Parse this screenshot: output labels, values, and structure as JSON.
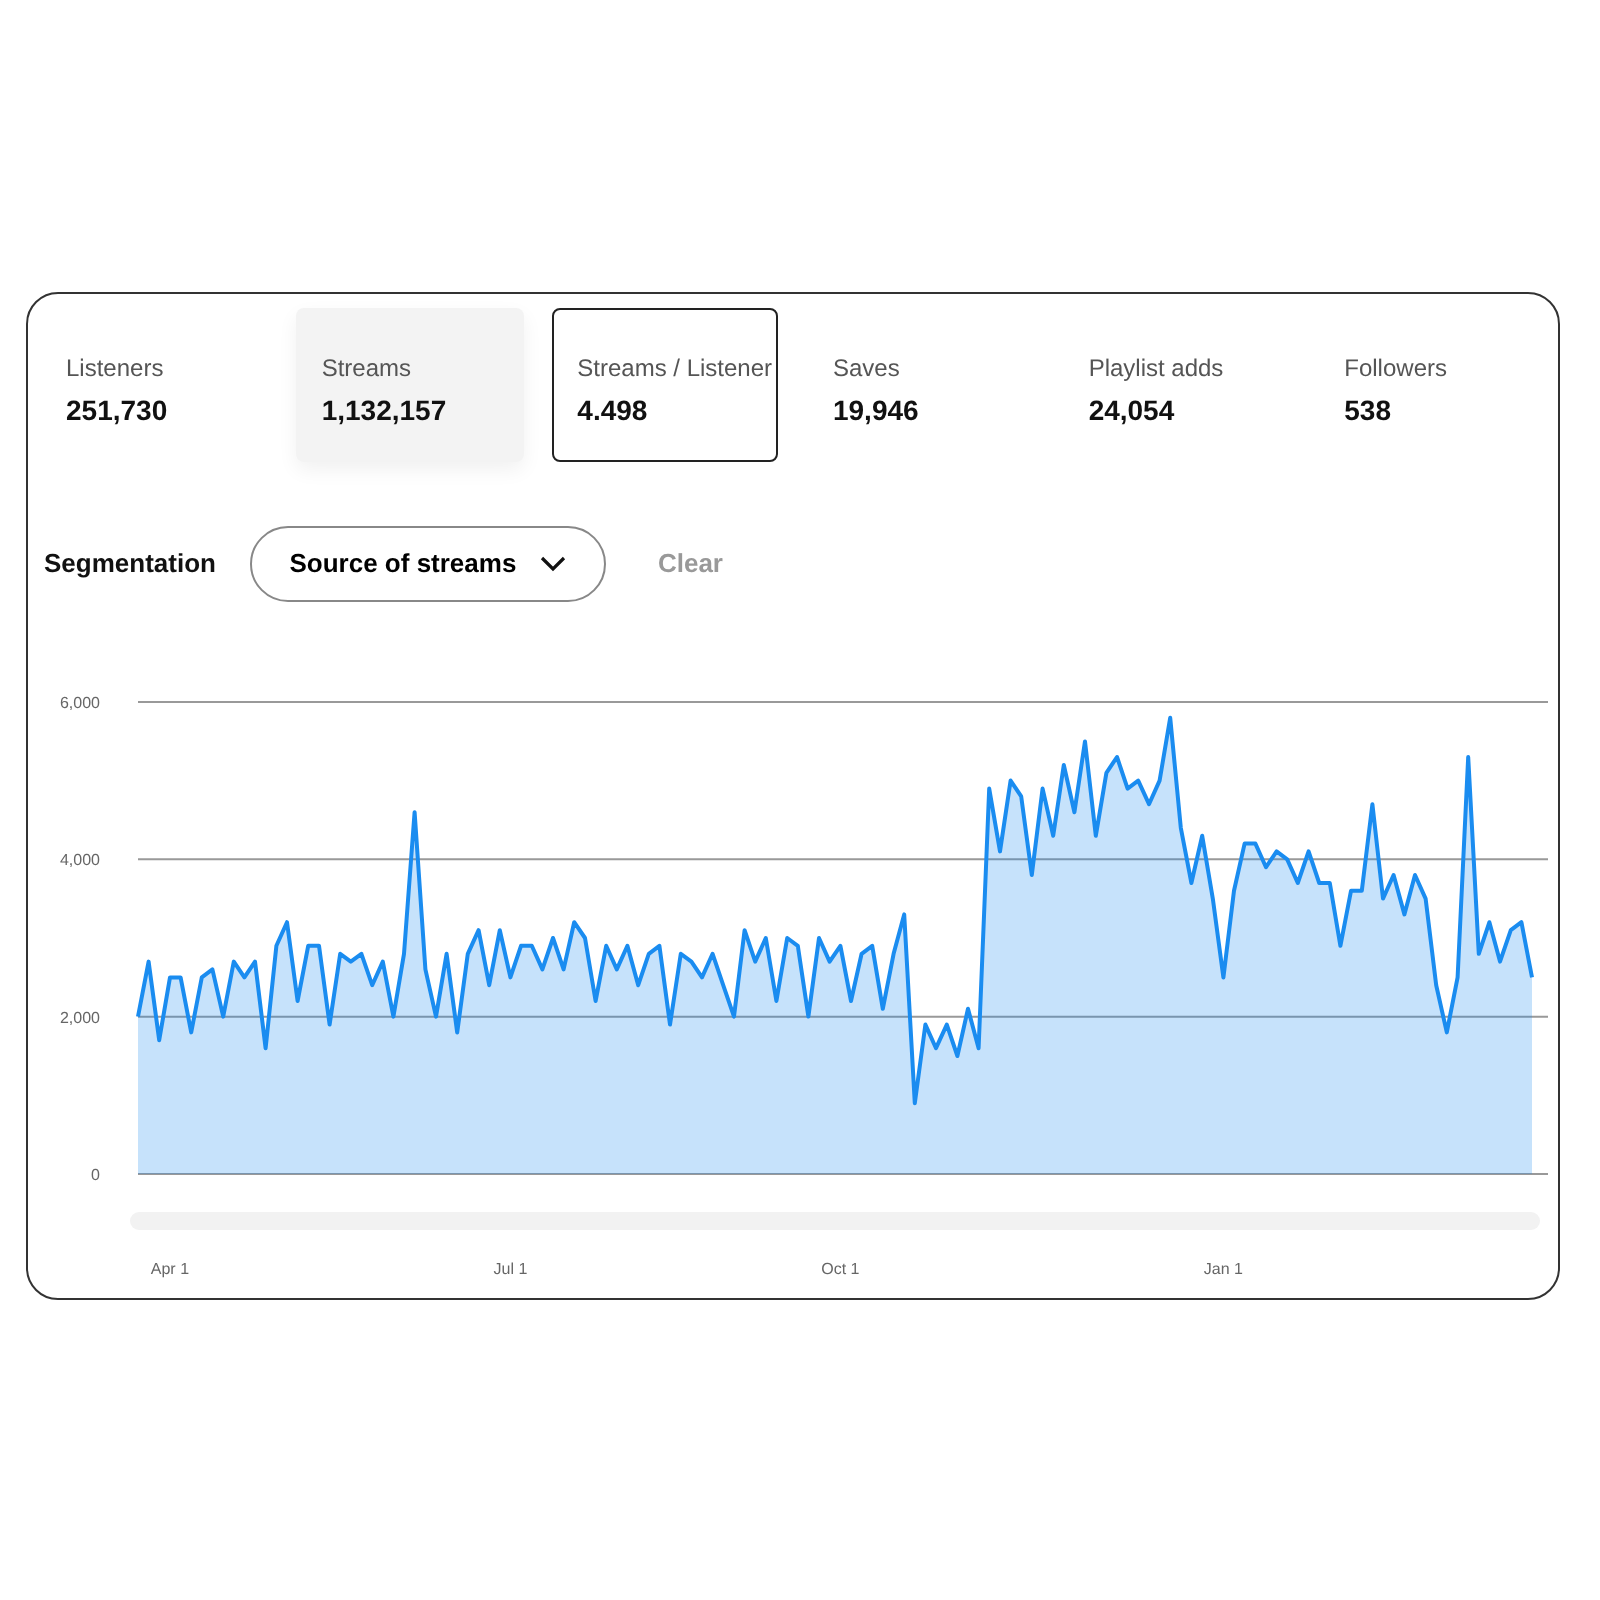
{
  "metrics": [
    {
      "label": "Listeners",
      "value": "251,730",
      "selected": false,
      "hovered": false
    },
    {
      "label": "Streams",
      "value": "1,132,157",
      "selected": false,
      "hovered": true
    },
    {
      "label": "Streams / Listener",
      "value": "4.498",
      "selected": true,
      "hovered": false
    },
    {
      "label": "Saves",
      "value": "19,946",
      "selected": false,
      "hovered": false
    },
    {
      "label": "Playlist adds",
      "value": "24,054",
      "selected": false,
      "hovered": false
    },
    {
      "label": "Followers",
      "value": "538",
      "selected": false,
      "hovered": false
    }
  ],
  "segmentation": {
    "label": "Segmentation",
    "dropdown": "Source of streams",
    "clear": {
      "label": "Clear",
      "disabled": true
    }
  },
  "chart": {
    "chart_data": {
      "type": "area",
      "ylim": [
        0,
        6000
      ],
      "yticks": [
        {
          "value": 0,
          "label": "0"
        },
        {
          "value": 2000,
          "label": "2,000"
        },
        {
          "value": 4000,
          "label": "4,000"
        },
        {
          "value": 6000,
          "label": "6,000"
        }
      ],
      "categories": [
        null,
        null,
        null,
        "Apr 1",
        null,
        null,
        null,
        null,
        null,
        null,
        null,
        null,
        null,
        null,
        null,
        null,
        null,
        null,
        null,
        null,
        null,
        null,
        null,
        null,
        null,
        null,
        null,
        null,
        null,
        null,
        null,
        null,
        null,
        null,
        null,
        "Jul 1",
        null,
        null,
        null,
        null,
        null,
        null,
        null,
        null,
        null,
        null,
        null,
        null,
        null,
        null,
        null,
        null,
        null,
        null,
        null,
        null,
        null,
        null,
        null,
        null,
        null,
        null,
        null,
        null,
        null,
        null,
        "Oct 1",
        null,
        null,
        null,
        null,
        null,
        null,
        null,
        null,
        null,
        null,
        null,
        null,
        null,
        null,
        null,
        null,
        null,
        null,
        null,
        null,
        null,
        null,
        null,
        null,
        null,
        null,
        null,
        null,
        null,
        null,
        null,
        null,
        null,
        null,
        null,
        "Jan 1",
        null,
        null,
        null,
        null,
        null,
        null,
        null,
        null,
        null,
        null,
        null,
        null,
        null,
        null,
        null,
        null,
        null,
        null,
        null,
        null,
        null,
        null,
        null,
        null,
        null,
        null,
        null,
        null,
        null
      ],
      "series": [
        {
          "color": "#1a8cf0",
          "values": [
            2000,
            2700,
            1700,
            2500,
            2500,
            1800,
            2500,
            2600,
            2000,
            2700,
            2500,
            2700,
            1600,
            2900,
            3200,
            2200,
            2900,
            2900,
            1900,
            2800,
            2700,
            2800,
            2400,
            2700,
            2000,
            2800,
            4600,
            2600,
            2000,
            2800,
            1800,
            2800,
            3100,
            2400,
            3100,
            2500,
            2900,
            2900,
            2600,
            3000,
            2600,
            3200,
            3000,
            2200,
            2900,
            2600,
            2900,
            2400,
            2800,
            2900,
            1900,
            2800,
            2700,
            2500,
            2800,
            2400,
            2000,
            3100,
            2700,
            3000,
            2200,
            3000,
            2900,
            2000,
            3000,
            2700,
            2900,
            2200,
            2800,
            2900,
            2100,
            2800,
            3300,
            900,
            1900,
            1600,
            1900,
            1500,
            2100,
            1600,
            4900,
            4100,
            5000,
            4800,
            3800,
            4900,
            4300,
            5200,
            4600,
            5500,
            4300,
            5100,
            5300,
            4900,
            5000,
            4700,
            5000,
            5800,
            4400,
            3700,
            4300,
            3500,
            2500,
            3600,
            4200,
            4200,
            3900,
            4100,
            4000,
            3700,
            4100,
            3700,
            3700,
            2900,
            3600,
            3600,
            4700,
            3500,
            3800,
            3300,
            3800,
            3500,
            2400,
            1800,
            2500,
            5300,
            2800,
            3200,
            2700,
            3100,
            3200,
            2500
          ]
        }
      ]
    }
  }
}
